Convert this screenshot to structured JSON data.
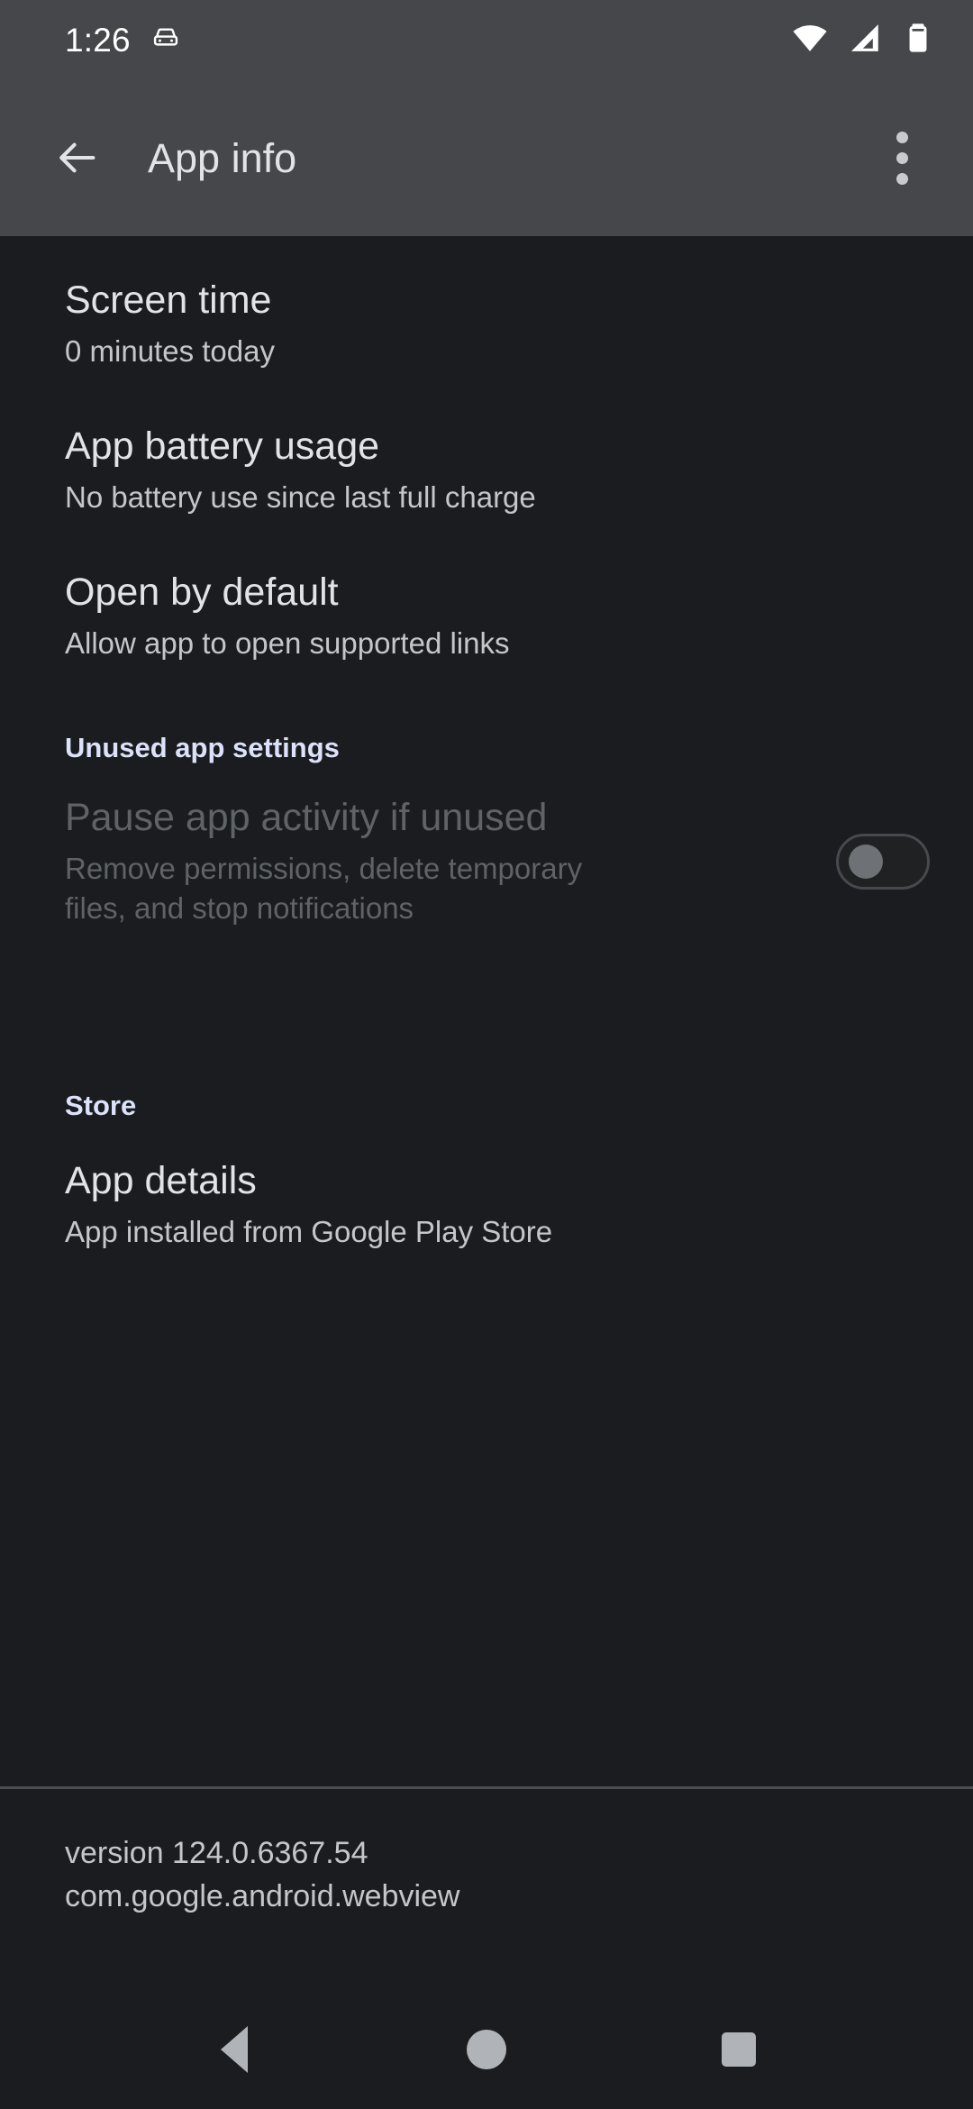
{
  "status_bar": {
    "clock": "1:26",
    "left_icons": [
      "car-icon"
    ],
    "right_icons": [
      "wifi-icon",
      "cellular-signal-icon",
      "battery-icon"
    ]
  },
  "app_bar": {
    "back_label": "Back",
    "title": "App info",
    "overflow_label": "More options"
  },
  "preferences": [
    {
      "key": "screen_time",
      "title": "Screen time",
      "summary": "0 minutes today"
    },
    {
      "key": "app_battery_usage",
      "title": "App battery usage",
      "summary": "No battery use since last full charge"
    },
    {
      "key": "open_by_default",
      "title": "Open by default",
      "summary": "Allow app to open supported links"
    }
  ],
  "unused_app_settings": {
    "header": "Unused app settings",
    "pause_activity": {
      "title": "Pause app activity if unused",
      "summary": "Remove permissions, delete temporary files, and stop notifications",
      "switch_state": "off",
      "enabled": false
    }
  },
  "store": {
    "header": "Store",
    "app_details": {
      "title": "App details",
      "summary": "App installed from Google Play Store"
    }
  },
  "footer": {
    "version": "version 124.0.6367.54",
    "package": "com.google.android.webview"
  },
  "nav_bar": {
    "back": "Back",
    "home": "Home",
    "recents": "Recents"
  },
  "colors": {
    "app_bar_bg": "#45474b",
    "content_bg": "#1a1c1f",
    "primary_text": "#e3e3e6",
    "secondary_text": "#c4c7c9",
    "disabled_text": "#5f6366",
    "accent": "#dce2f9",
    "nav_icon": "#b0b3b8"
  }
}
